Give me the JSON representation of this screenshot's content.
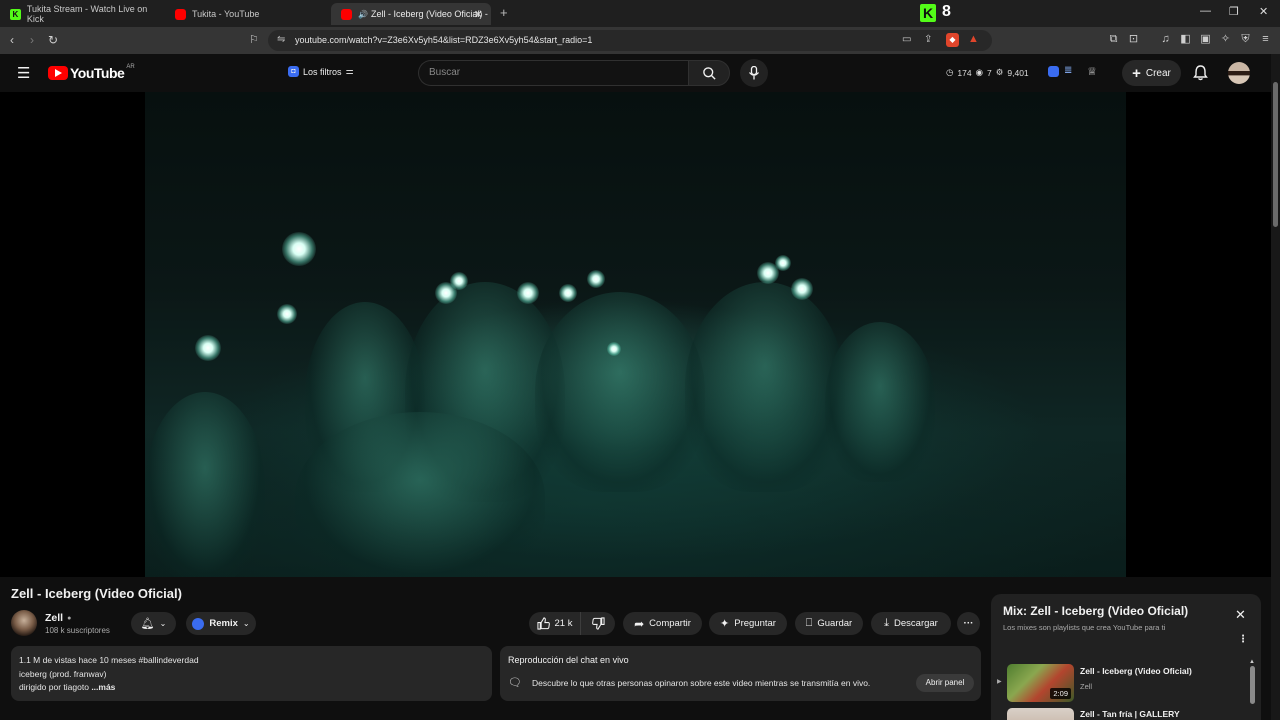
{
  "browser": {
    "tabs": [
      {
        "title": "Tukita Stream - Watch Live on Kick",
        "favicon_color": "#53fc18",
        "icon": "kick-logo-icon"
      },
      {
        "title": "Tukita - YouTube",
        "favicon_color": "#ff0000",
        "icon": "youtube-logo-icon"
      },
      {
        "title": "Zell - Iceberg (Video Oficial) -",
        "favicon_color": "#ff0000",
        "icon": "youtube-logo-icon",
        "active": true
      }
    ],
    "kick_badge": "8",
    "url": "youtube.com/watch?v=Z3e6Xv5yh54&list=RDZ3e6Xv5yh54&start_radio=1"
  },
  "youtube": {
    "logo_text": "YouTube",
    "country_code": "AR",
    "filters_label": "Los filtros",
    "search_placeholder": "Buscar",
    "stats": {
      "views": "174",
      "likes": "7",
      "count": "9,401"
    },
    "create_label": "Crear"
  },
  "video": {
    "title": "Zell - Iceberg (Video Oficial)",
    "channel": "Zell",
    "subscribers": "108 k suscriptores",
    "remix_label": "Remix",
    "likes": "21 k",
    "share_label": "Compartir",
    "ask_label": "Preguntar",
    "save_label": "Guardar",
    "download_label": "Descargar"
  },
  "description": {
    "line1": "1.1 M de vistas  hace 10 meses  #ballindeverdad",
    "line2": "iceberg (prod. franwav)",
    "line3": "dirigido por tiagoto",
    "more": "...más"
  },
  "chat_replay": {
    "title": "Reproducción del chat en vivo",
    "text": "Descubre lo que otras personas opinaron sobre este video mientras se transmitía en vivo.",
    "button": "Abrir panel"
  },
  "mix": {
    "title": "Mix: Zell - Iceberg (Video Oficial)",
    "subtitle": "Los mixes son playlists que crea YouTube para ti",
    "items": [
      {
        "title": "Zell - Iceberg (Video Oficial)",
        "channel": "Zell",
        "duration": "2:09"
      },
      {
        "title": "Zell - Tan fría | GALLERY",
        "channel": "",
        "duration": ""
      }
    ]
  },
  "colors": {
    "accent": "#ff0000",
    "kick": "#53fc18",
    "bg": "#0f0f0f",
    "pill": "#272727"
  }
}
